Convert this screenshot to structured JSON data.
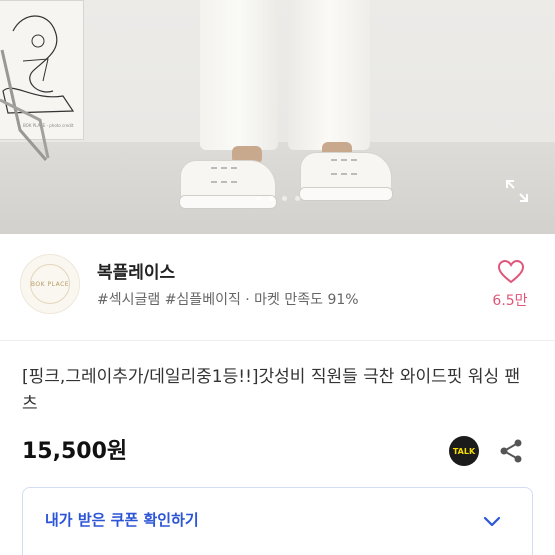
{
  "hero": {
    "poster_caption": "BOK PLACE · photo credit",
    "slide_count": 4,
    "active_slide": 2
  },
  "seller": {
    "logo_text": "BOK PLACE",
    "name": "복플레이스",
    "tags": "#섹시글램 #심플베이직 · 마켓 만족도 91%",
    "likes": "6.5만"
  },
  "product": {
    "title": "[핑크,그레이추가/데일리중1등!!]갓성비 직원들 극찬 와이드핏 워싱 팬츠",
    "price": "15,500원",
    "talk_label": "TALK"
  },
  "coupon": {
    "label": "내가 받은 쿠폰 확인하기"
  },
  "colors": {
    "accent": "#2b55d6",
    "like": "#e0567a"
  }
}
